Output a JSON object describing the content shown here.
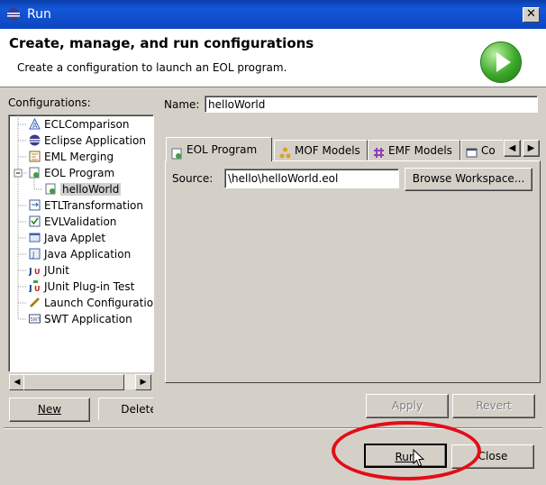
{
  "window": {
    "title": "Run",
    "close_label": "✕"
  },
  "header": {
    "title": "Create, manage, and run configurations",
    "subtitle": "Create a configuration to launch an EOL program."
  },
  "configurations": {
    "label": "Configurations:",
    "items": [
      {
        "label": "ECLComparison",
        "icon": "ecl-icon"
      },
      {
        "label": "Eclipse Application",
        "icon": "eclipse-app-icon"
      },
      {
        "label": "EML Merging",
        "icon": "eml-icon"
      },
      {
        "label": "EOL Program",
        "icon": "eol-icon"
      },
      {
        "label": "helloWorld",
        "icon": "eol-config-icon"
      },
      {
        "label": "ETLTransformation",
        "icon": "etl-icon"
      },
      {
        "label": "EVLValidation",
        "icon": "evl-icon"
      },
      {
        "label": "Java Applet",
        "icon": "java-applet-icon"
      },
      {
        "label": "Java Application",
        "icon": "java-app-icon"
      },
      {
        "label": "JUnit",
        "icon": "junit-icon"
      },
      {
        "label": "JUnit Plug-in Test",
        "icon": "junit-plugin-icon"
      },
      {
        "label": "Launch Configuration",
        "icon": "launch-config-icon"
      },
      {
        "label": "SWT Application",
        "icon": "swt-icon"
      }
    ],
    "selected": "helloWorld"
  },
  "left_buttons": {
    "new": "New",
    "delete": "Delete"
  },
  "name": {
    "label": "Name:",
    "value": "helloWorld"
  },
  "tabs": [
    {
      "label": "EOL Program",
      "active": true
    },
    {
      "label": "MOF Models"
    },
    {
      "label": "EMF Models"
    },
    {
      "label": "Co"
    }
  ],
  "source": {
    "label": "Source:",
    "value": "\\hello\\helloWorld.eol",
    "browse": "Browse Workspace..."
  },
  "bottom": {
    "apply": "Apply",
    "revert": "Revert",
    "run": "Run",
    "close": "Close"
  },
  "colors": {
    "highlight_circle": "#e30d18",
    "title_bar": "#0c46c2"
  }
}
